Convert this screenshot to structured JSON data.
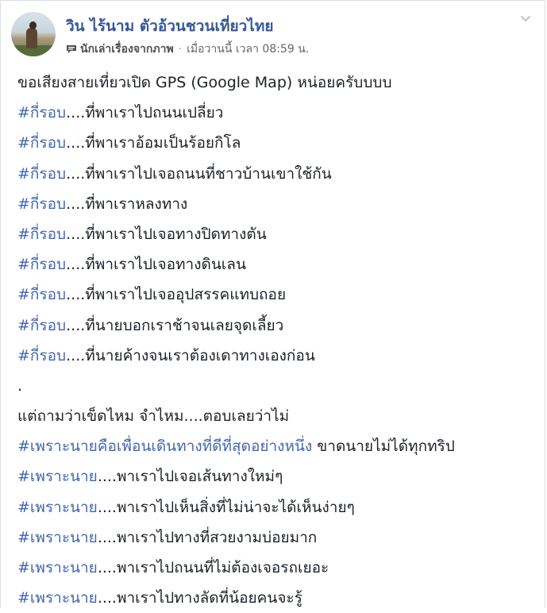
{
  "post": {
    "author": "วิน ไร้นาม ตัวอ้วนชวนเที่ยวไทย",
    "badge_icon": "speech-bubble-icon",
    "badge_label": "นักเล่าเรื่องจากภาพ",
    "separator": "·",
    "time": "เมื่อวานนี้ เวลา 08:59 น.",
    "menu_icon": "chevron-down-icon",
    "accent_color": "#365899",
    "hashtag_color": "#4267b2"
  },
  "lines": [
    {
      "tag": "",
      "text": "ขอเสียงสายเที่ยวเปิด GPS (Google Map) หน่อยครับบบบ"
    },
    {
      "tag": "#กี่รอบ",
      "text": "....ที่พาเราไปถนนเปลี่ยว"
    },
    {
      "tag": "#กี่รอบ",
      "text": "....ที่พาเราอ้อมเป็นร้อยกิโล"
    },
    {
      "tag": "#กี่รอบ",
      "text": "....ที่พาเราไปเจอถนนที่ชาวบ้านเขาใช้กัน"
    },
    {
      "tag": "#กี่รอบ",
      "text": "....ที่พาเราหลงทาง"
    },
    {
      "tag": "#กี่รอบ",
      "text": "....ที่พาเราไปเจอทางปิดทางตัน"
    },
    {
      "tag": "#กี่รอบ",
      "text": "....ที่พาเราไปเจอทางดินเลน"
    },
    {
      "tag": "#กี่รอบ",
      "text": "....ที่พาเราไปเจออุปสรรคแทบถอย"
    },
    {
      "tag": "#กี่รอบ",
      "text": "....ที่นายบอกเราช้าจนเลยจุดเลี้ยว"
    },
    {
      "tag": "#กี่รอบ",
      "text": "....ที่นายค้างจนเราต้องเดาทางเองก่อน"
    },
    {
      "tag": "",
      "text": "."
    },
    {
      "tag": "",
      "text": "แต่ถามว่าเข็ดไหม จำไหม....ตอบเลยว่าไม่"
    },
    {
      "tag": "#เพราะนายคือเพื่อนเดินทางที่ดีที่สุดอย่างหนึ่ง",
      "text": " ขาดนายไม่ได้ทุกทริป"
    },
    {
      "tag": "#เพราะนาย",
      "text": "....พาเราไปเจอเส้นทางใหม่ๆ"
    },
    {
      "tag": "#เพราะนาย",
      "text": "....พาเราไปเห็นสิ่งที่ไม่น่าจะได้เห็นง่ายๆ"
    },
    {
      "tag": "#เพราะนาย",
      "text": "....พาเราไปทางที่สวยงามบ่อยมาก"
    },
    {
      "tag": "#เพราะนาย",
      "text": "....พาเราไปถนนที่ไม่ต้องเจอรถเยอะ"
    },
    {
      "tag": "#เพราะนาย",
      "text": "....พาเราไปทางลัดที่น้อยคนจะรู้"
    }
  ]
}
